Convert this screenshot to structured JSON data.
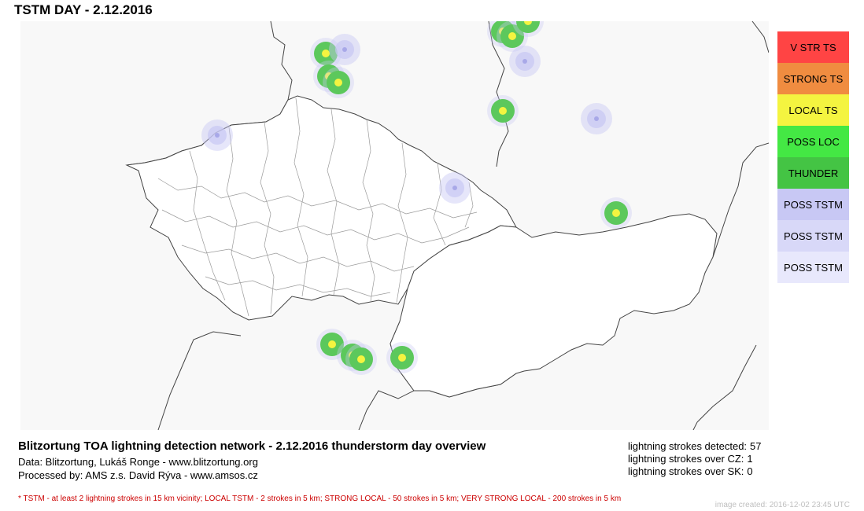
{
  "header": {
    "title": "TSTM DAY - 2.12.2016"
  },
  "legend": {
    "items": [
      {
        "label": "V STR TS",
        "color": "#ff4444"
      },
      {
        "label": "STRONG TS",
        "color": "#f08c40"
      },
      {
        "label": "LOCAL TS",
        "color": "#f4f440"
      },
      {
        "label": "POSS LOC",
        "color": "#44e844"
      },
      {
        "label": "THUNDER",
        "color": "#44c444"
      },
      {
        "label": "POSS TSTM",
        "color": "#c8c8f4"
      },
      {
        "label": "POSS TSTM",
        "color": "#d8d8f8"
      },
      {
        "label": "POSS TSTM",
        "color": "#e8e8fc"
      }
    ]
  },
  "markers": [
    {
      "type": "thunder"
    },
    {
      "type": "poss"
    },
    {
      "type": "thunder"
    },
    {
      "type": "thunder"
    },
    {
      "type": "thunder"
    },
    {
      "type": "thunder"
    },
    {
      "type": "poss"
    },
    {
      "type": "thunder"
    },
    {
      "type": "poss"
    },
    {
      "type": "poss"
    },
    {
      "type": "poss"
    },
    {
      "type": "thunder"
    },
    {
      "type": "thunder"
    },
    {
      "type": "thunder"
    },
    {
      "type": "thunder"
    },
    {
      "type": "thunder"
    },
    {
      "type": "thunder"
    }
  ],
  "caption": {
    "title": "Blitzortung TOA lightning detection network - 2.12.2016  thunderstorm day overview",
    "data_line": "Data: Blitzortung, Lukáš Ronge - www.blitzortung.org",
    "processed_line": "Processed by: AMS z.s. David Rýva - www.amsos.cz"
  },
  "stats": [
    {
      "label": "lightning strokes detected:",
      "value": "57"
    },
    {
      "label": "lightning strokes over CZ:",
      "value": "1"
    },
    {
      "label": "lightning strokes over SK:",
      "value": "0"
    }
  ],
  "footnote": "* TSTM - at least 2 lightning strokes in 15 km vicinity; LOCAL TSTM - 2 strokes in 5 km; STRONG LOCAL - 50 strokes in 5 km; VERY STRONG LOCAL - 200 strokes in 5 km",
  "timestamp": "image created: 2016-12-02 23:45 UTC",
  "colors": {
    "map_background": "#f8f8f8",
    "thunder": "#5cc85c",
    "core": "#f4f440",
    "poss": "#c8c8f4"
  }
}
